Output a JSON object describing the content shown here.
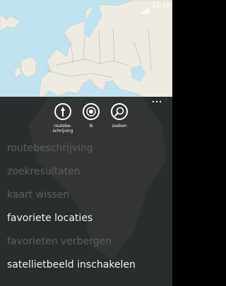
{
  "status_bar": {
    "time": "12:16"
  },
  "app_bar": {
    "actions": [
      {
        "label": "routebe-\nschrijving",
        "icon": "directions-icon"
      },
      {
        "label": "ik",
        "icon": "me-location-icon"
      },
      {
        "label": "zoeken",
        "icon": "search-icon"
      }
    ],
    "more_icon": "ellipsis-icon"
  },
  "menu": {
    "items": [
      {
        "label": "routebeschrijving",
        "enabled": false
      },
      {
        "label": "zoekresultaten",
        "enabled": false
      },
      {
        "label": "kaart wissen",
        "enabled": false
      },
      {
        "label": "favoriete locaties",
        "enabled": true
      },
      {
        "label": "favorieten verbergen",
        "enabled": false
      },
      {
        "label": "satellietbeeld inschakelen",
        "enabled": true
      }
    ]
  },
  "colors": {
    "sea": "#bfe2ee",
    "land": "#eeebe3",
    "panel": "#2a2d2d",
    "disabled_text": "#5c5e5c"
  }
}
